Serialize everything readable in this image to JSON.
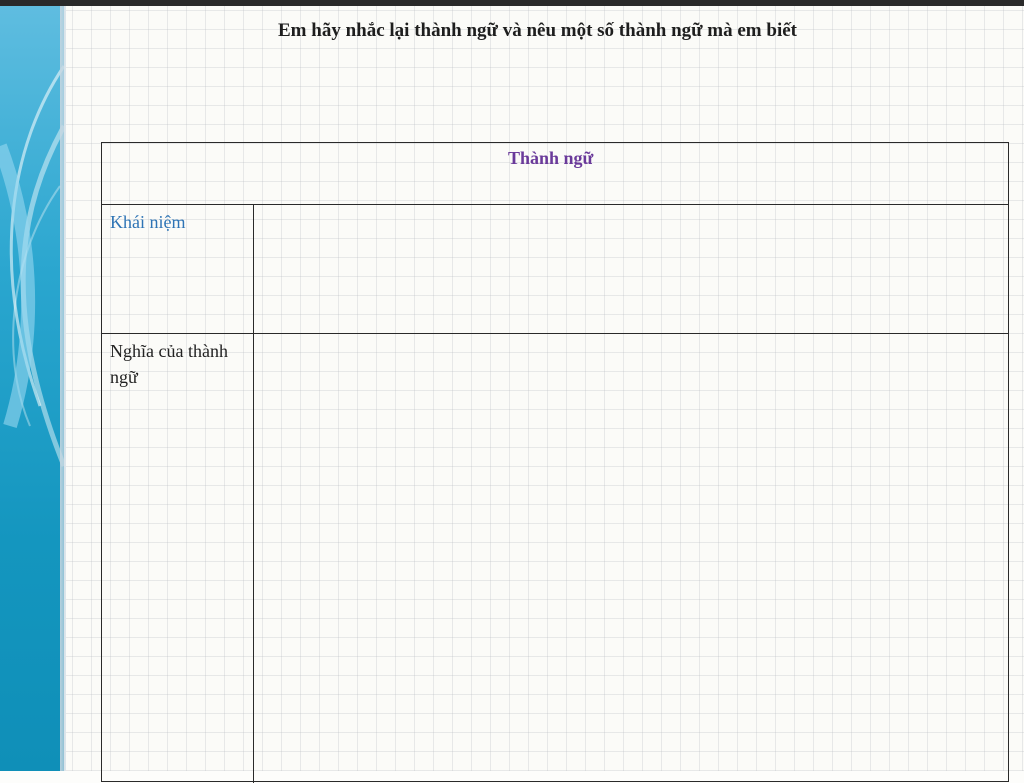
{
  "slide": {
    "title": "Em hãy nhắc lại thành ngữ và nêu một số thành ngữ mà em biết"
  },
  "table": {
    "header": "Thành ngữ",
    "rows": [
      {
        "label": "Khái niệm",
        "value": ""
      },
      {
        "label": "Nghĩa của thành ngữ",
        "value": ""
      }
    ]
  },
  "colors": {
    "header_text": "#6a3a9a",
    "concept_label": "#2e74b5",
    "side_panel": "#1496bf"
  }
}
